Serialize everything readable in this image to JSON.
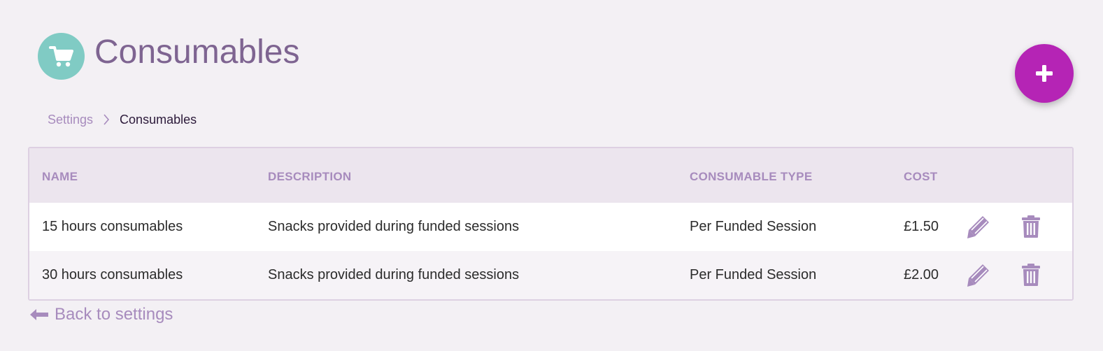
{
  "header": {
    "title": "Consumables",
    "icon": "shopping-cart-icon"
  },
  "fab": {
    "icon": "plus-icon"
  },
  "breadcrumb": {
    "items": [
      {
        "label": "Settings"
      },
      {
        "label": "Consumables"
      }
    ]
  },
  "table": {
    "columns": [
      "NAME",
      "DESCRIPTION",
      "CONSUMABLE TYPE",
      "COST"
    ],
    "rows": [
      {
        "name": "15 hours consumables",
        "description": "Snacks provided during funded sessions",
        "type": "Per Funded Session",
        "cost": "£1.50"
      },
      {
        "name": "30 hours consumables",
        "description": "Snacks provided during funded sessions",
        "type": "Per Funded Session",
        "cost": "£2.00"
      }
    ],
    "row_actions": [
      "pencil-icon",
      "trash-icon"
    ]
  },
  "footer": {
    "back_label": "Back to settings",
    "back_icon": "arrow-left-icon"
  },
  "colors": {
    "background": "#f3f0f4",
    "accent": "#b524b5",
    "teal": "#80cbc4",
    "title": "#7e6491",
    "muted_purple": "#a78bbd"
  }
}
